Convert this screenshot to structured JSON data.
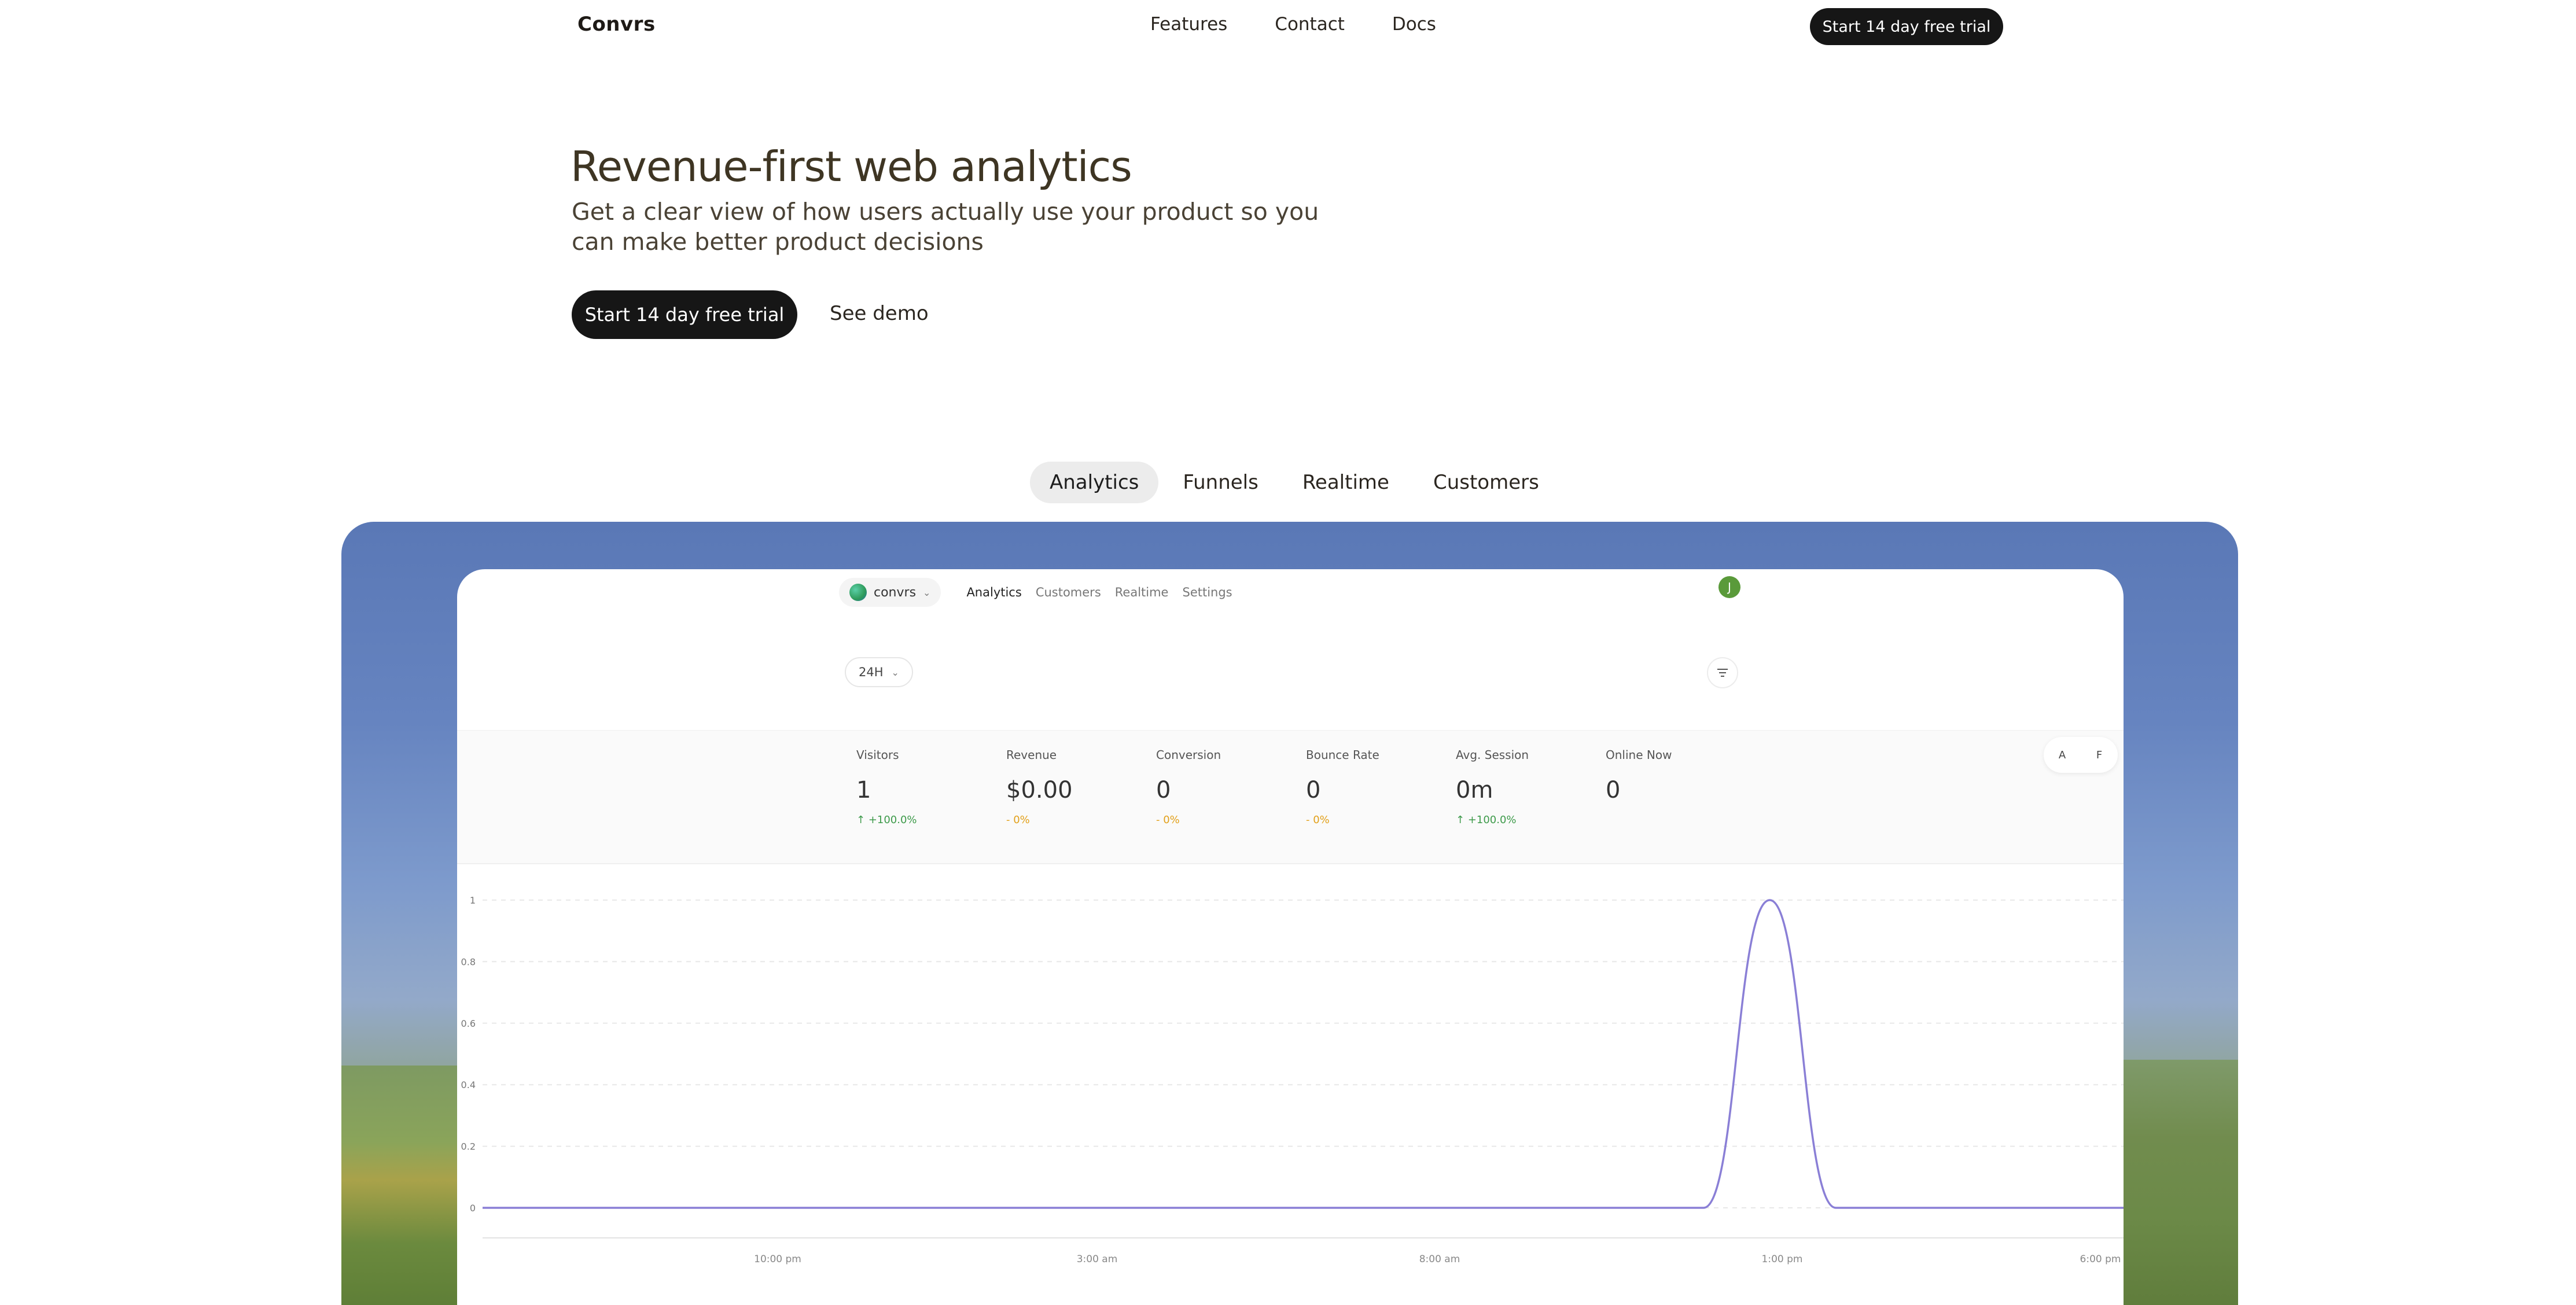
{
  "nav": {
    "brand": "Convrs",
    "links": [
      "Features",
      "Contact",
      "Docs"
    ],
    "cta": "Start 14 day free trial"
  },
  "hero": {
    "title": "Revenue-first web analytics",
    "subtitle": "Get a clear view of how users actually use your product so you can make better product decisions",
    "cta": "Start 14 day free trial",
    "demo": "See demo"
  },
  "tabs": [
    {
      "label": "Analytics",
      "active": true
    },
    {
      "label": "Funnels",
      "active": false
    },
    {
      "label": "Realtime",
      "active": false
    },
    {
      "label": "Customers",
      "active": false
    }
  ],
  "dashboard": {
    "workspace": "convrs",
    "links": [
      {
        "label": "Analytics",
        "active": true
      },
      {
        "label": "Customers",
        "active": false
      },
      {
        "label": "Realtime",
        "active": false
      },
      {
        "label": "Settings",
        "active": false
      }
    ],
    "avatar": "J",
    "range": "24H",
    "toggles": [
      "A",
      "F"
    ],
    "stats": [
      {
        "label": "Visitors",
        "value": "1",
        "delta": "+100.0%",
        "trend": "up"
      },
      {
        "label": "Revenue",
        "value": "$0.00",
        "delta": "- 0%",
        "trend": "flat"
      },
      {
        "label": "Conversion",
        "value": "0",
        "delta": "- 0%",
        "trend": "flat"
      },
      {
        "label": "Bounce Rate",
        "value": "0",
        "delta": "- 0%",
        "trend": "flat"
      },
      {
        "label": "Avg. Session",
        "value": "0m",
        "delta": "+100.0%",
        "trend": "up"
      },
      {
        "label": "Online Now",
        "value": "0",
        "delta": "",
        "trend": "none"
      }
    ],
    "colors": {
      "line": "#8a7fd6",
      "up": "#3d9a4a",
      "flat": "#e2a019"
    }
  },
  "chart_data": {
    "type": "line",
    "x_ticks": [
      "10:00 pm",
      "3:00 am",
      "8:00 am",
      "1:00 pm",
      "6:00 pm"
    ],
    "y_ticks": [
      "0",
      "0.2",
      "0.4",
      "0.6",
      "0.8",
      "1"
    ],
    "ylim": [
      0,
      1
    ],
    "grid": true,
    "series": [
      {
        "x": [
          "10:00 pm",
          "3:00 am",
          "8:00 am",
          "12:00 pm",
          "1:00 pm",
          "2:00 pm",
          "6:00 pm"
        ],
        "values": [
          0,
          0,
          0,
          0,
          1,
          0,
          0
        ]
      }
    ]
  }
}
